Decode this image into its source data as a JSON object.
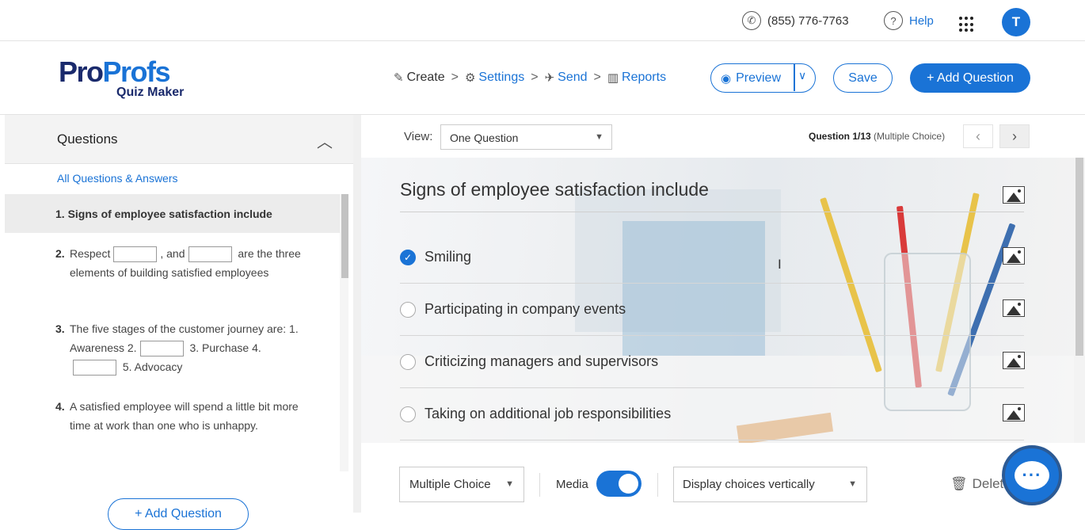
{
  "topbar": {
    "phone": "(855) 776-7763",
    "help": "Help",
    "apps_icon": "apps-grid-icon",
    "avatar_letter": "T",
    "accent": "#1a73d6"
  },
  "logo": {
    "part1": "Pro",
    "part2": "Profs",
    "sub": "Quiz Maker"
  },
  "breadcrumb": {
    "create": "Create",
    "settings": "Settings",
    "send": "Send",
    "reports": "Reports",
    "sep": ">"
  },
  "header_buttons": {
    "preview": "Preview",
    "save": "Save",
    "add_question": "+ Add Question"
  },
  "sidebar": {
    "title": "Questions",
    "all_link": "All Questions & Answers",
    "q1": "1. Signs of employee satisfaction include",
    "questions": [
      {
        "num": "2.",
        "a": "Respect",
        "b": ", and",
        "c": "are the three elements of building satisfied employees"
      },
      {
        "num": "3.",
        "a": "The five stages of the customer journey are: 1. Awareness 2.",
        "b": "3. Purchase",
        "c": "4.",
        "d": "5. Advocacy"
      },
      {
        "num": "4.",
        "text": "A satisfied employee will spend a little bit more time at work than one who is unhappy."
      }
    ],
    "add_question": "+ Add Question"
  },
  "viewbar": {
    "view_label": "View:",
    "view_value": "One Question",
    "counter_bold": "Question 1/13",
    "counter_rest": " (Multiple Choice)"
  },
  "question": {
    "title": "Signs of employee satisfaction include",
    "choices": [
      {
        "text": "Smiling",
        "selected": true
      },
      {
        "text": "Participating in company events",
        "selected": false
      },
      {
        "text": "Criticizing managers and supervisors",
        "selected": false
      },
      {
        "text": "Taking on additional job responsibilities",
        "selected": false
      }
    ]
  },
  "toolbar": {
    "type": "Multiple Choice",
    "media_label": "Media",
    "media_on": true,
    "display": "Display choices vertically",
    "delete": "Delet"
  }
}
